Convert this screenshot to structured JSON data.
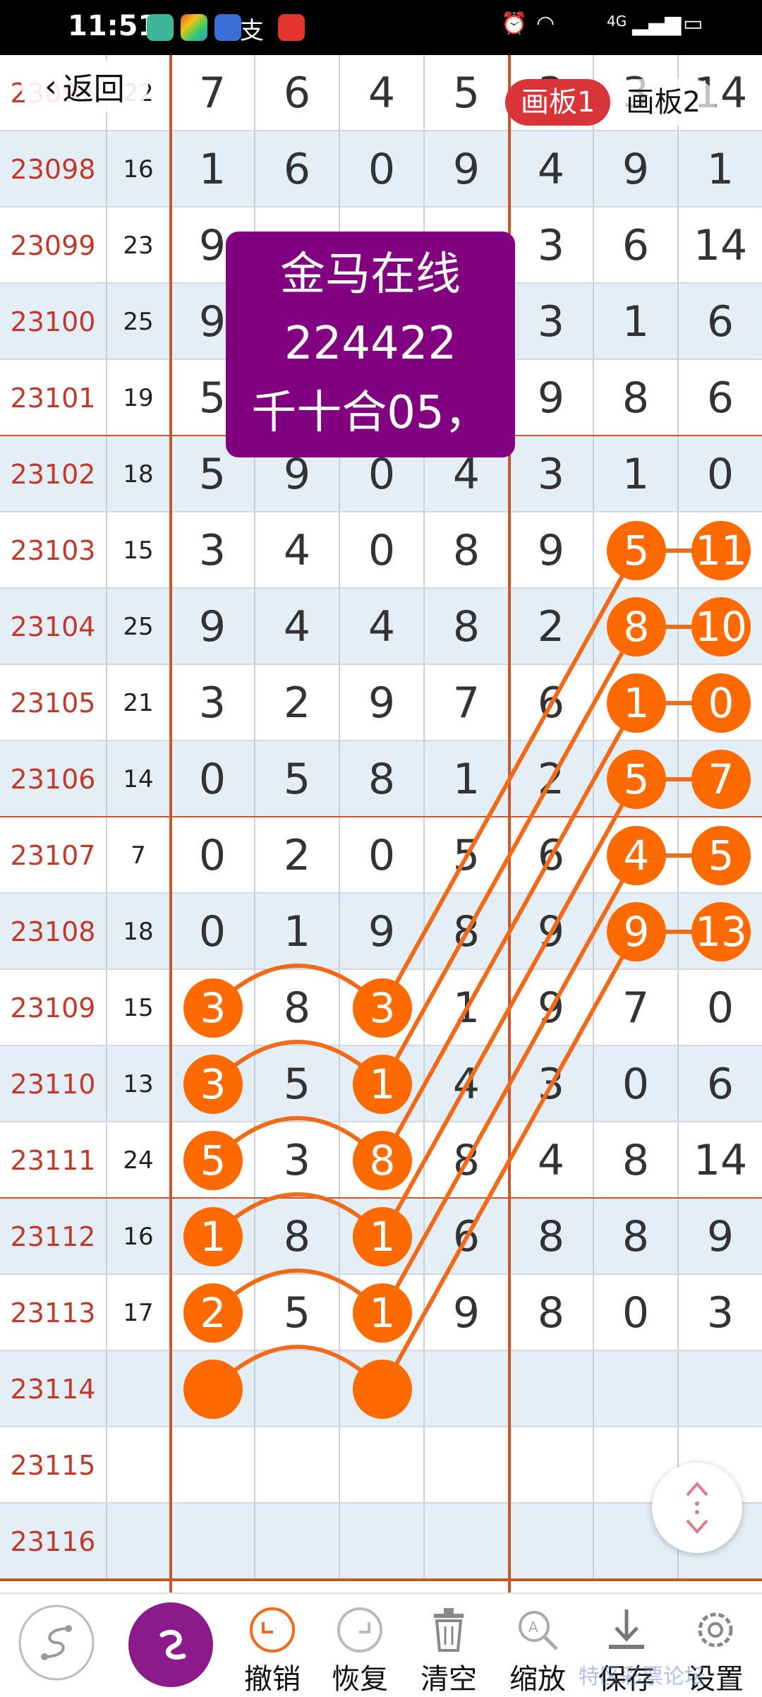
{
  "status_bar": {
    "time": "11:51",
    "network": "4G",
    "icons": [
      "wallet-app-icon",
      "color-app-icon",
      "music-app-icon",
      "alipay-icon",
      "pingan-bank-icon",
      "alarm-icon",
      "wifi-icon",
      "signal-icon",
      "battery-icon"
    ]
  },
  "nav": {
    "back_label": "返回"
  },
  "tabs": [
    {
      "label": "画板1",
      "active": true
    },
    {
      "label": "画板2",
      "active": false
    }
  ],
  "popup": {
    "lines": [
      "金马在线",
      "224422",
      "千十合05，"
    ]
  },
  "rows": [
    {
      "id": "23097",
      "sum": "22",
      "nums": [
        "7",
        "6",
        "4",
        "5",
        "3",
        "3",
        "14"
      ]
    },
    {
      "id": "23098",
      "sum": "16",
      "nums": [
        "1",
        "6",
        "0",
        "9",
        "4",
        "9",
        "1"
      ]
    },
    {
      "id": "23099",
      "sum": "23",
      "nums": [
        "9",
        "",
        "",
        "",
        "3",
        "6",
        "14"
      ]
    },
    {
      "id": "23100",
      "sum": "25",
      "nums": [
        "9",
        "",
        "",
        "",
        "3",
        "1",
        "6"
      ]
    },
    {
      "id": "23101",
      "sum": "19",
      "nums": [
        "5",
        "",
        "",
        "",
        "9",
        "8",
        "6"
      ]
    },
    {
      "id": "23102",
      "sum": "18",
      "nums": [
        "5",
        "9",
        "0",
        "4",
        "3",
        "1",
        "0"
      ]
    },
    {
      "id": "23103",
      "sum": "15",
      "nums": [
        "3",
        "4",
        "0",
        "8",
        "9",
        "5",
        "11"
      ]
    },
    {
      "id": "23104",
      "sum": "25",
      "nums": [
        "9",
        "4",
        "4",
        "8",
        "2",
        "8",
        "10"
      ]
    },
    {
      "id": "23105",
      "sum": "21",
      "nums": [
        "3",
        "2",
        "9",
        "7",
        "6",
        "1",
        "0"
      ]
    },
    {
      "id": "23106",
      "sum": "14",
      "nums": [
        "0",
        "5",
        "8",
        "1",
        "2",
        "5",
        "7"
      ]
    },
    {
      "id": "23107",
      "sum": "7",
      "nums": [
        "0",
        "2",
        "0",
        "5",
        "6",
        "4",
        "5"
      ]
    },
    {
      "id": "23108",
      "sum": "18",
      "nums": [
        "0",
        "1",
        "9",
        "8",
        "9",
        "9",
        "13"
      ]
    },
    {
      "id": "23109",
      "sum": "15",
      "nums": [
        "3",
        "8",
        "3",
        "1",
        "9",
        "7",
        "0"
      ]
    },
    {
      "id": "23110",
      "sum": "13",
      "nums": [
        "3",
        "5",
        "1",
        "4",
        "3",
        "0",
        "6"
      ]
    },
    {
      "id": "23111",
      "sum": "24",
      "nums": [
        "5",
        "3",
        "8",
        "8",
        "4",
        "8",
        "14"
      ]
    },
    {
      "id": "23112",
      "sum": "16",
      "nums": [
        "1",
        "8",
        "1",
        "6",
        "8",
        "8",
        "9"
      ]
    },
    {
      "id": "23113",
      "sum": "17",
      "nums": [
        "2",
        "5",
        "1",
        "9",
        "8",
        "0",
        "3"
      ]
    },
    {
      "id": "23114",
      "sum": "",
      "nums": [
        "",
        "",
        "",
        "",
        "",
        "",
        ""
      ]
    },
    {
      "id": "23115",
      "sum": "",
      "nums": [
        "",
        "",
        "",
        "",
        "",
        "",
        ""
      ]
    },
    {
      "id": "23116",
      "sum": "",
      "nums": [
        "",
        "",
        "",
        "",
        "",
        "",
        ""
      ]
    }
  ],
  "marks": {
    "highlighted": [
      {
        "row": 6,
        "col": 5
      },
      {
        "row": 6,
        "col": 6
      },
      {
        "row": 7,
        "col": 5
      },
      {
        "row": 7,
        "col": 6
      },
      {
        "row": 8,
        "col": 5
      },
      {
        "row": 8,
        "col": 6
      },
      {
        "row": 9,
        "col": 5
      },
      {
        "row": 9,
        "col": 6
      },
      {
        "row": 10,
        "col": 5
      },
      {
        "row": 10,
        "col": 6
      },
      {
        "row": 11,
        "col": 5
      },
      {
        "row": 11,
        "col": 6
      },
      {
        "row": 12,
        "col": 0
      },
      {
        "row": 12,
        "col": 2
      },
      {
        "row": 13,
        "col": 0
      },
      {
        "row": 13,
        "col": 2
      },
      {
        "row": 14,
        "col": 0
      },
      {
        "row": 14,
        "col": 2
      },
      {
        "row": 15,
        "col": 0
      },
      {
        "row": 15,
        "col": 2
      },
      {
        "row": 16,
        "col": 0
      },
      {
        "row": 16,
        "col": 2
      },
      {
        "row": 17,
        "col": 0
      },
      {
        "row": 17,
        "col": 2
      }
    ],
    "arcs": [
      {
        "row": 12,
        "from": 0,
        "to": 2
      },
      {
        "row": 13,
        "from": 0,
        "to": 2
      },
      {
        "row": 14,
        "from": 0,
        "to": 2
      },
      {
        "row": 15,
        "from": 0,
        "to": 2
      },
      {
        "row": 16,
        "from": 0,
        "to": 2
      },
      {
        "row": 17,
        "from": 0,
        "to": 2
      }
    ],
    "pair_links": [
      {
        "row": 6
      },
      {
        "row": 7
      },
      {
        "row": 8
      },
      {
        "row": 9
      },
      {
        "row": 10
      },
      {
        "row": 11
      }
    ],
    "diagonals": [
      {
        "from_row": 12,
        "from_col": 2,
        "to_row": 6,
        "to_col": 5
      },
      {
        "from_row": 13,
        "from_col": 2,
        "to_row": 7,
        "to_col": 5
      },
      {
        "from_row": 14,
        "from_col": 2,
        "to_row": 8,
        "to_col": 5
      },
      {
        "from_row": 15,
        "from_col": 2,
        "to_row": 9,
        "to_col": 5
      },
      {
        "from_row": 16,
        "from_col": 2,
        "to_row": 10,
        "to_col": 5
      },
      {
        "from_row": 17,
        "from_col": 2,
        "to_row": 11,
        "to_col": 5
      }
    ]
  },
  "toolbar": {
    "items": [
      {
        "name": "pen-tool",
        "label": ""
      },
      {
        "name": "draw-mode",
        "label": ""
      },
      {
        "name": "undo",
        "label": "撤销"
      },
      {
        "name": "redo",
        "label": "恢复"
      },
      {
        "name": "clear",
        "label": "清空"
      },
      {
        "name": "zoom",
        "label": "缩放"
      },
      {
        "name": "save",
        "label": "保存"
      },
      {
        "name": "settings",
        "label": "设置"
      }
    ]
  },
  "watermark": "特区彩票论坛",
  "colors": {
    "accent": "#ff6a00",
    "arc": "#f06a1a",
    "row_alt": "#e4eef7",
    "id_text": "#c0392b",
    "grid_divider": "#c9572c",
    "popup_bg": "#800080",
    "tab_active": "#d9343a"
  }
}
